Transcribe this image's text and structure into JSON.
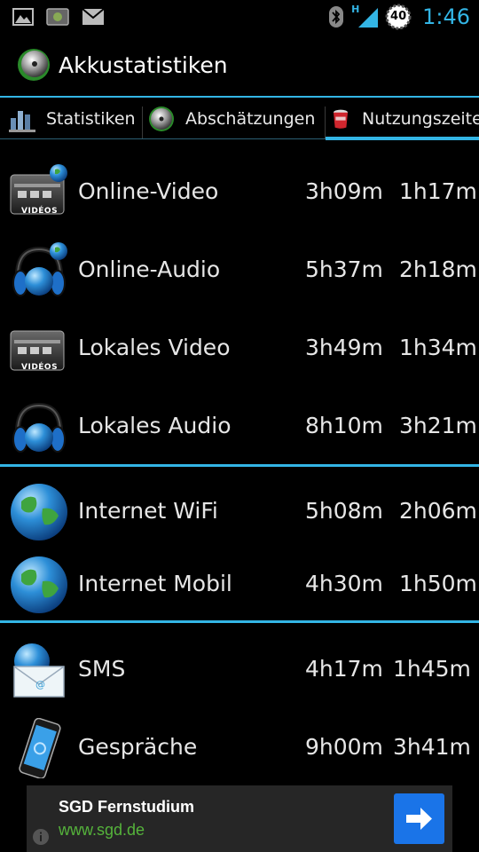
{
  "status_bar": {
    "clock": "1:46",
    "battery_level": "40",
    "network": "H"
  },
  "app": {
    "title": "Akkustatistiken"
  },
  "tabs": [
    {
      "label": "Statistiken",
      "icon": "bar-chart-icon"
    },
    {
      "label": "Abschätzungen",
      "icon": "disc-icon"
    },
    {
      "label": "Nutzungszeiten",
      "icon": "battery-cup-icon",
      "selected": true
    }
  ],
  "rows": [
    {
      "label": "Online-Video",
      "value1": "3h09m",
      "value2": "1h17m",
      "icon": "video-clapper-globe-icon"
    },
    {
      "label": "Online-Audio",
      "value1": "5h37m",
      "value2": "2h18m",
      "icon": "headphones-globe-icon"
    },
    {
      "label": "Lokales Video",
      "value1": "3h49m",
      "value2": "1h34m",
      "icon": "video-clapper-icon"
    },
    {
      "label": "Lokales Audio",
      "value1": "8h10m",
      "value2": "3h21m",
      "icon": "headphones-icon"
    },
    {
      "label": "Internet WiFi",
      "value1": "5h08m",
      "value2": "2h06m",
      "icon": "globe-icon"
    },
    {
      "label": "Internet Mobil",
      "value1": "4h30m",
      "value2": "1h50m",
      "icon": "globe-icon"
    },
    {
      "label": "SMS",
      "value1": "4h17m",
      "value2": "1h45m",
      "icon": "envelope-globe-icon"
    },
    {
      "label": "Gespräche",
      "value1": "9h00m",
      "value2": "3h41m",
      "icon": "phone-icon"
    }
  ],
  "video_badge": "VIDÉOS",
  "ad": {
    "title": "SGD Fernstudium",
    "url": "www.sgd.de"
  },
  "colors": {
    "accent": "#33b5e5",
    "ad_url": "#55b33b",
    "ad_button": "#1a74e8"
  }
}
